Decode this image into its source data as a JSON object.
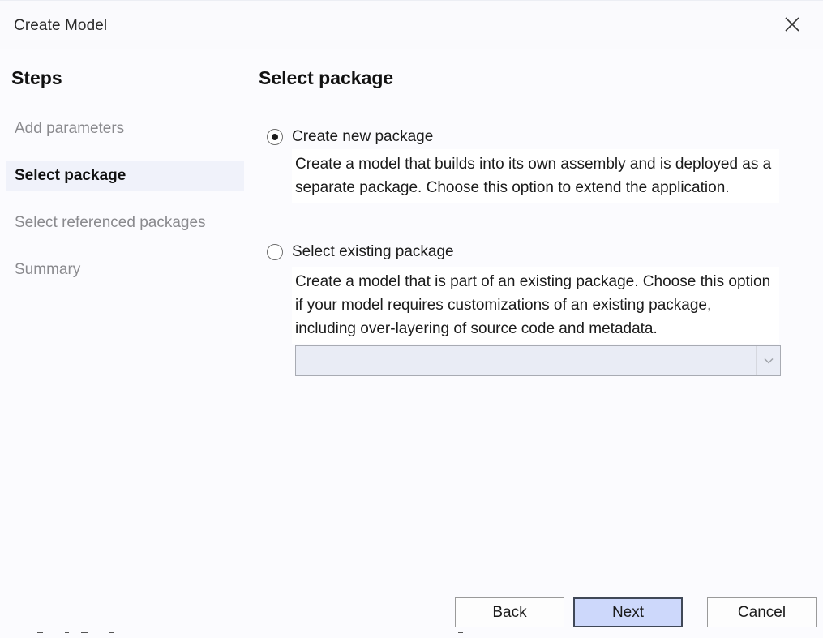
{
  "window": {
    "title": "Create Model",
    "close_icon": "close-icon"
  },
  "steps": {
    "heading": "Steps",
    "items": [
      {
        "label": "Add parameters",
        "state": "inactive"
      },
      {
        "label": "Select package",
        "state": "active"
      },
      {
        "label": "Select referenced packages",
        "state": "inactive"
      },
      {
        "label": "Summary",
        "state": "inactive"
      }
    ]
  },
  "main": {
    "heading": "Select package",
    "options": [
      {
        "label": "Create new package",
        "checked": true,
        "description": "Create a model that builds into its own assembly and is deployed as a separate package. Choose this option to extend the application."
      },
      {
        "label": "Select existing package",
        "checked": false,
        "description": "Create a model that is part of an existing package. Choose this option if your model requires customizations of an existing package, including over-layering of source code and metadata."
      }
    ],
    "package_dropdown": {
      "selected": "",
      "icon": "chevron-down-icon",
      "enabled": false
    }
  },
  "footer": {
    "back_label": "Back",
    "next_label": "Next",
    "cancel_label": "Cancel"
  },
  "colors": {
    "background": "#fbfbfe",
    "active_step_bg": "#f0f2fa",
    "inactive_step_text": "#8a8a8e",
    "primary_button_bg": "#cdd8fb",
    "dropdown_bg": "#e9ecf5"
  }
}
